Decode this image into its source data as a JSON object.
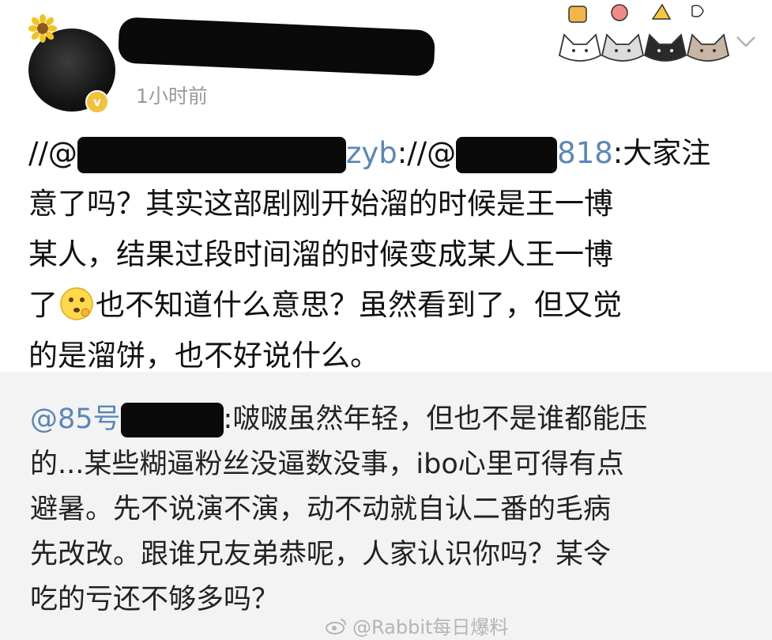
{
  "post": {
    "time": "1小时前",
    "body_line1_prefix": "//@",
    "body_line1_user1_tail": "zyb",
    "body_line1_sep": "://@",
    "body_line1_user2_tail": "818",
    "body_line1_colon_text": ":大家注",
    "body_line2": "意了吗？其实这部剧刚开始溜的时候是王一博",
    "body_line3": "某人，结果过段时间溜的时候变成某人王一博",
    "body_line4_before": "了",
    "body_line4_after": "也不知道什么意思？虽然看到了，但又觉",
    "body_line5": "的是溜饼，也不好说什么。",
    "emoji_icon": "thinking-face-icon"
  },
  "quote": {
    "mention_prefix": "@85号",
    "line1_text": ":啵啵虽然年轻，但也不是谁都能压",
    "line2": "的...某些糊逼粉丝没逼数没事，ibo心里可得有点",
    "line3": "避暑。先不说演不演，动不动就自认二番的毛病",
    "line4": "先改改。跟谁兄友弟恭呢，人家认识你吗？某令",
    "line5": "吃的亏还不够多吗？"
  },
  "watermark": {
    "text": "@Rabbit每日爆料",
    "icon": "weibo-logo-icon"
  },
  "colors": {
    "mention": "#5b87b8",
    "quote_bg": "#f3f3f3",
    "timestamp": "#9a9a9a",
    "badge": "#f2c23a"
  }
}
